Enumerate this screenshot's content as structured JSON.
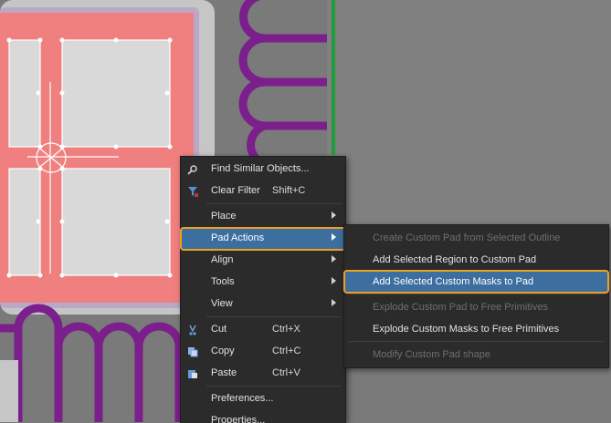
{
  "context_menu": {
    "items": [
      {
        "label": "Find Similar Objects...",
        "icon": "find-similar-icon"
      },
      {
        "label": "Clear Filter",
        "shortcut": "Shift+C",
        "icon": "clear-filter-icon"
      },
      {
        "label": "Place",
        "submenu": true
      },
      {
        "label": "Pad Actions",
        "submenu": true,
        "state": "highlighted"
      },
      {
        "label": "Align",
        "submenu": true
      },
      {
        "label": "Tools",
        "submenu": true
      },
      {
        "label": "View",
        "submenu": true
      },
      {
        "label": "Cut",
        "shortcut": "Ctrl+X",
        "icon": "cut-icon"
      },
      {
        "label": "Copy",
        "shortcut": "Ctrl+C",
        "icon": "copy-icon"
      },
      {
        "label": "Paste",
        "shortcut": "Ctrl+V",
        "icon": "paste-icon"
      },
      {
        "label": "Preferences..."
      },
      {
        "label": "Properties..."
      }
    ]
  },
  "pad_actions_submenu": {
    "items": [
      {
        "label": "Create Custom Pad from Selected Outline",
        "enabled": false
      },
      {
        "label": "Add Selected Region to Custom Pad",
        "enabled": true
      },
      {
        "label": "Add Selected Custom Masks to Pad",
        "enabled": true,
        "state": "highlighted"
      },
      {
        "label": "Explode Custom Pad to Free Primitives",
        "enabled": false
      },
      {
        "label": "Explode Custom Masks to Free Primitives",
        "enabled": true
      },
      {
        "label": "Modify Custom Pad shape",
        "enabled": false
      }
    ]
  },
  "colors": {
    "board_background": "#7a7a7a",
    "pad_fill": "#f08080",
    "pad_inner": "#d9d9d9",
    "trace_purple": "#7b1f8c",
    "track_green": "#1e9e3a",
    "menu_background": "#2b2b2b",
    "highlight": "#3c6ea0",
    "focus_outline": "#f0a020"
  }
}
